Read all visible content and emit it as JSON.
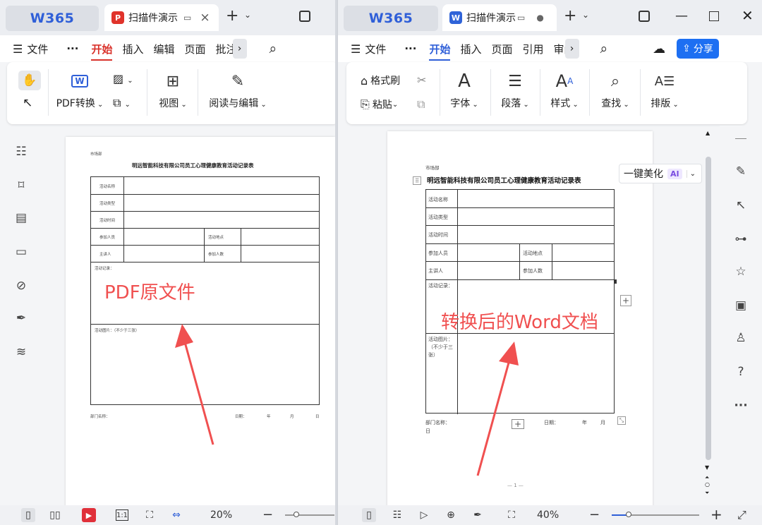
{
  "left": {
    "logo": "W365",
    "tab_title": "扫描件演示",
    "tab_close": "×",
    "menu": {
      "file": "文件",
      "more": "···",
      "items": [
        "开始",
        "插入",
        "编辑",
        "页面",
        "批注"
      ],
      "active": "开始"
    },
    "ribbon": {
      "pdf_convert": "PDF转换",
      "view": "视图",
      "read_edit": "阅读与编辑"
    },
    "zoom": "20%"
  },
  "right": {
    "logo": "W365",
    "tab_title": "扫描件演示",
    "menu": {
      "file": "文件",
      "more": "···",
      "items": [
        "开始",
        "插入",
        "页面",
        "引用",
        "审阅"
      ],
      "active": "开始"
    },
    "share": "分享",
    "ribbon": {
      "format_brush": "格式刷",
      "paste": "粘贴",
      "font": "字体",
      "paragraph": "段落",
      "style": "样式",
      "find": "查找",
      "layout": "排版"
    },
    "beautify": "一键美化",
    "ai": "AI",
    "zoom": "40%",
    "page_num": "— 1 —"
  },
  "doc": {
    "header_small": "市场部",
    "title": "明远智能科技有限公司员工心理健康教育活动记录表",
    "rows": {
      "name": "活动名称",
      "type": "活动类型",
      "time": "活动时间",
      "participants": "参加人员",
      "location": "活动地点",
      "speaker": "主讲人",
      "count": "参加人数",
      "record": "活动记录：",
      "photos": "活动图片：（不少于三张）"
    },
    "record_r": "活动记录：",
    "photos_r": "活动图片：（不少于三张）",
    "footer": {
      "dept": "部门名称：",
      "date": "日期：",
      "year": "年",
      "month": "月",
      "day": "日"
    }
  },
  "annotations": {
    "left": "PDF原文件",
    "right": "转换后的Word文档"
  },
  "colors": {
    "accent": "#d9322b",
    "arrow": "#f05050",
    "share": "#1d6ff2"
  }
}
